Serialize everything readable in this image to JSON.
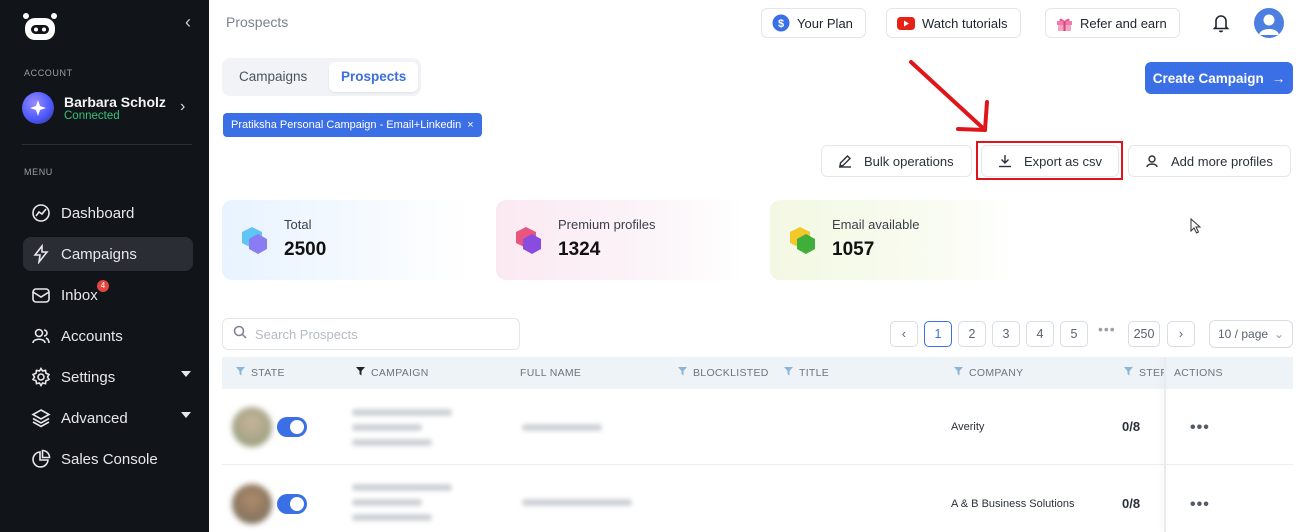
{
  "sidebar": {
    "account_label": "ACCOUNT",
    "account_name": "Barbara Scholz",
    "account_status": "Connected",
    "menu_label": "MENU",
    "items": [
      {
        "label": "Dashboard",
        "icon": "dashboard-icon"
      },
      {
        "label": "Campaigns",
        "icon": "campaigns-icon",
        "active": true
      },
      {
        "label": "Inbox",
        "icon": "inbox-icon",
        "badge": "4"
      },
      {
        "label": "Accounts",
        "icon": "accounts-icon"
      },
      {
        "label": "Settings",
        "icon": "gear-icon"
      },
      {
        "label": "Advanced",
        "icon": "layers-icon"
      },
      {
        "label": "Sales Console",
        "icon": "pie-chart-icon"
      }
    ]
  },
  "header": {
    "title": "Prospects",
    "your_plan": "Your Plan",
    "watch_tutorials": "Watch tutorials",
    "refer_earn": "Refer and earn"
  },
  "tabs": [
    "Campaigns",
    "Prospects"
  ],
  "create_campaign": "Create Campaign",
  "filter_chip": "Pratiksha Personal Campaign - Email+Linkedin",
  "actions": {
    "bulk": "Bulk operations",
    "export": "Export as csv",
    "add_profiles": "Add more profiles"
  },
  "stats": [
    {
      "label": "Total",
      "value": "2500"
    },
    {
      "label": "Premium profiles",
      "value": "1324"
    },
    {
      "label": "Email available",
      "value": "1057"
    }
  ],
  "search": {
    "placeholder": "Search Prospects"
  },
  "pagination": {
    "pages": [
      "1",
      "2",
      "3",
      "4",
      "5"
    ],
    "dots": "•••",
    "last": "250",
    "current": "1",
    "page_size": "10 / page"
  },
  "table": {
    "columns": [
      "STATE",
      "CAMPAIGN",
      "FULL NAME",
      "BLOCKLISTED",
      "TITLE",
      "COMPANY",
      "STEP",
      "ACTIONS"
    ],
    "rows": [
      {
        "company": "Averity",
        "step": "0/8"
      },
      {
        "company": "A & B Business Solutions",
        "step": "0/8"
      }
    ]
  },
  "colors": {
    "sidebar_bg": "#111418",
    "accent": "#3a6fe6",
    "connected": "#36c37a",
    "highlight": "#e0151a"
  }
}
